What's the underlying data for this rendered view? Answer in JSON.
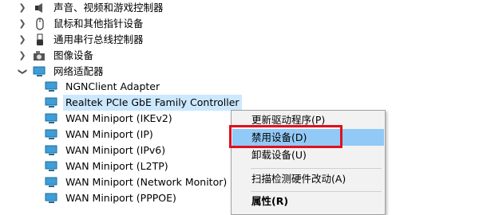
{
  "tree": {
    "categories": [
      {
        "label": "声音、视频和游戏控制器",
        "icon": "speaker-icon",
        "expanded": false
      },
      {
        "label": "鼠标和其他指针设备",
        "icon": "mouse-icon",
        "expanded": false
      },
      {
        "label": "通用串行总线控制器",
        "icon": "usb-icon",
        "expanded": false
      },
      {
        "label": "图像设备",
        "icon": "camera-icon",
        "expanded": false
      },
      {
        "label": "网络适配器",
        "icon": "network-adapter-icon",
        "expanded": true
      }
    ],
    "adapters": [
      {
        "label": "NGNClient Adapter",
        "selected": false
      },
      {
        "label": "Realtek PCIe GbE Family Controller",
        "selected": true
      },
      {
        "label": "WAN Miniport (IKEv2)",
        "selected": false
      },
      {
        "label": "WAN Miniport (IP)",
        "selected": false
      },
      {
        "label": "WAN Miniport (IPv6)",
        "selected": false
      },
      {
        "label": "WAN Miniport (L2TP)",
        "selected": false
      },
      {
        "label": "WAN Miniport (Network Monitor)",
        "selected": false
      },
      {
        "label": "WAN Miniport (PPPOE)",
        "selected": false
      }
    ]
  },
  "context_menu": {
    "items": [
      {
        "label": "更新驱动程序(P)",
        "highlighted": false,
        "bold": false
      },
      {
        "label": "禁用设备(D)",
        "highlighted": true,
        "bold": false
      },
      {
        "label": "卸载设备(U)",
        "highlighted": false,
        "bold": false
      },
      {
        "label": "扫描检测硬件改动(A)",
        "highlighted": false,
        "bold": false
      },
      {
        "label": "属性(R)",
        "highlighted": false,
        "bold": true
      }
    ]
  },
  "colors": {
    "selection": "#cce8ff",
    "menu_highlight": "#91c9f7",
    "annotation_box": "#e0101e",
    "menu_background": "#f2f2f2"
  }
}
